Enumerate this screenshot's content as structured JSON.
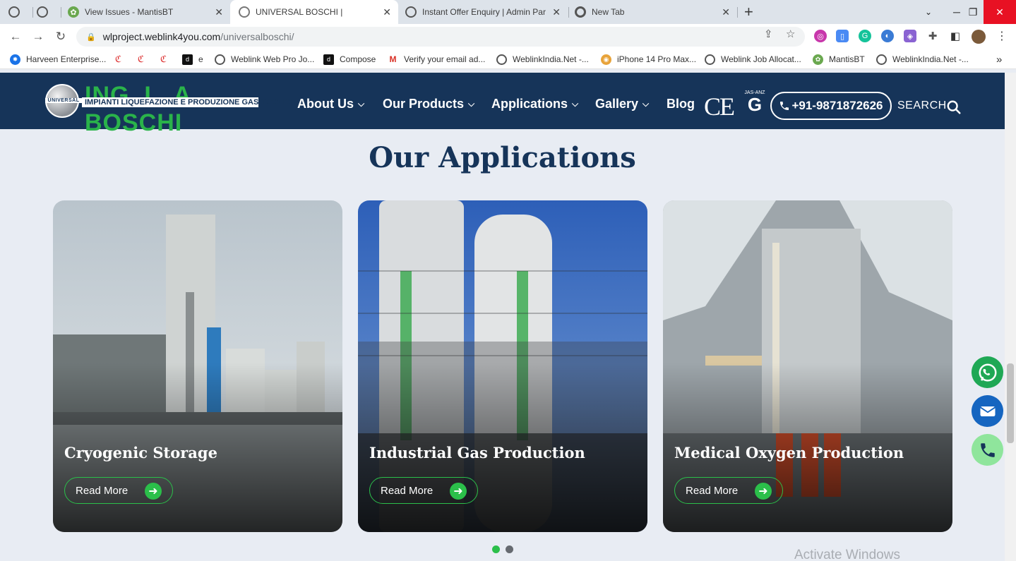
{
  "browser": {
    "tabs": [
      {
        "title": "",
        "icon": "globe-icon"
      },
      {
        "title": "",
        "icon": "globe-icon"
      },
      {
        "title": "View Issues - MantisBT",
        "icon": "mantis-icon"
      },
      {
        "title": "UNIVERSAL BOSCHI |",
        "icon": "globe-icon",
        "active": true
      },
      {
        "title": "Instant Offer Enquiry | Admin Par",
        "icon": "globe-icon"
      },
      {
        "title": "New Tab",
        "icon": "chrome-icon"
      }
    ],
    "new_tab": "+",
    "url_host": "wlproject.weblink4you.com",
    "url_path": "/universalboschi/",
    "bookmarks": [
      "Harveen Enterprise...",
      "",
      "",
      "",
      "e",
      "Weblink Web Pro Jo...",
      "Compose",
      "Verify your email ad...",
      "WeblinkIndia.Net -...",
      "iPhone 14 Pro Max...",
      "Weblink Job Allocat...",
      "MantisBT",
      "WeblinkIndia.Net -..."
    ],
    "more_bookmarks": "»"
  },
  "header": {
    "logo_title": "ING. L. A. BOSCHI",
    "logo_badge": "UNIVERSAL",
    "logo_sub": "IMPIANTI LIQUEFAZIONE E PRODUZIONE GAS TECNICI",
    "nav": [
      {
        "label": "About Us",
        "dropdown": true
      },
      {
        "label": "Our Products",
        "dropdown": true
      },
      {
        "label": "Applications",
        "dropdown": true
      },
      {
        "label": "Gallery",
        "dropdown": true
      },
      {
        "label": "Blog",
        "dropdown": false
      }
    ],
    "ce_mark": "CE",
    "jas_label": "JAS-ANZ",
    "phone": "+91-9871872626",
    "search_label": "SEARCH"
  },
  "main": {
    "title": "Our Applications",
    "cards": [
      {
        "title": "Cryogenic Storage",
        "button": "Read More"
      },
      {
        "title": "Industrial Gas Production",
        "button": "Read More"
      },
      {
        "title": "Medical Oxygen Production",
        "button": "Read More"
      }
    ],
    "carousel": {
      "pages": 2,
      "active": 1
    }
  },
  "watermark": "Activate Windows",
  "colors": {
    "navy": "#163459",
    "green": "#2bbf4a",
    "page_bg": "#e8ecf3",
    "tabbar": "#dde3ea"
  }
}
